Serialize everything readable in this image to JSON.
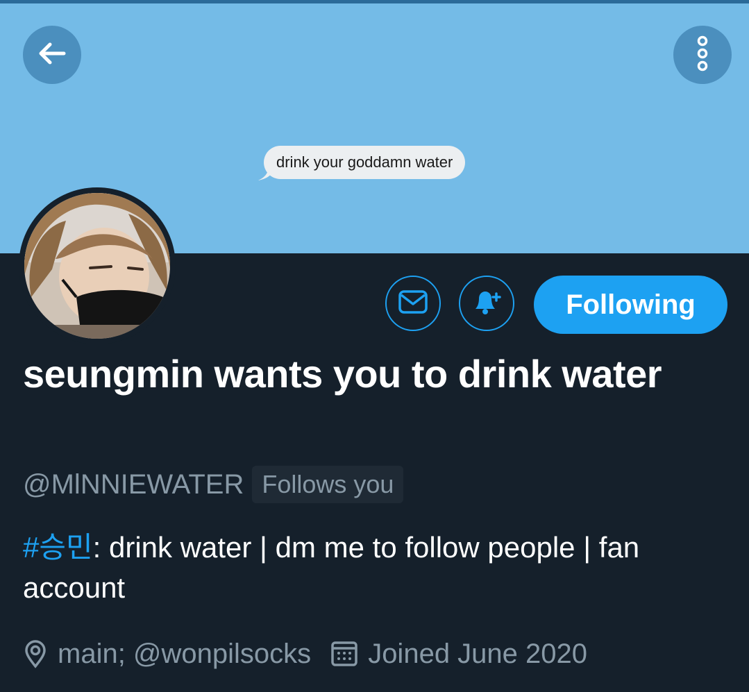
{
  "banner": {
    "bubble_text": "drink your goddamn water"
  },
  "actions": {
    "following_label": "Following"
  },
  "profile": {
    "display_name": "seungmin wants you to drink water",
    "handle": "@MlNNIEWATER",
    "follows_you": "Follows you",
    "bio_tag": "#승민",
    "bio_text": ": drink water | dm me to follow people | fan account",
    "location": "main; @wonpilsocks",
    "joined": "Joined June 2020"
  },
  "colors": {
    "accent": "#1da1f2",
    "banner": "#74bbe7",
    "background": "#15202b",
    "muted_text": "#8899a6"
  },
  "icons": [
    "back-arrow-icon",
    "more-options-icon",
    "mail-icon",
    "bell-plus-icon",
    "location-pin-icon",
    "calendar-icon"
  ]
}
